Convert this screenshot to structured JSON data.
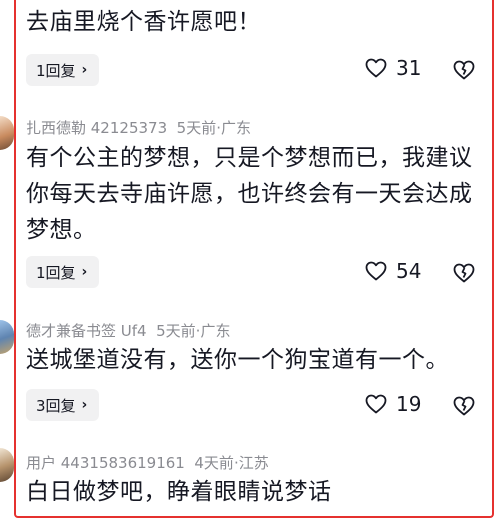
{
  "comments": [
    {
      "text": "去庙里烧个香许愿吧！",
      "reply_label": "1回复",
      "likes": "31",
      "icons": {
        "like": "heart-outline-icon",
        "dislike": "heart-broken-outline-icon",
        "reply_chevron": "chevron-right-icon"
      }
    },
    {
      "username": "扎西德勒 42125373",
      "time": "5天前",
      "location": "广东",
      "separator": "·",
      "text": "有个公主的梦想，只是个梦想而已，我建议\n你每天去寺庙许愿，也许终会有一天会达成\n梦想。",
      "reply_label": "1回复",
      "likes": "54"
    },
    {
      "username": "德才兼备书签 Uf4",
      "time": "5天前",
      "location": "广东",
      "separator": "·",
      "text": "送城堡道没有，送你一个狗宝道有一个。",
      "reply_label": "3回复",
      "likes": "19"
    },
    {
      "username": "用户 4431583619161",
      "time": "4天前",
      "location": "江苏",
      "separator": "·",
      "text": "白日做梦吧，睁着眼睛说梦话"
    }
  ],
  "colors": {
    "frame": "#e5312f",
    "meta": "#8a8b91",
    "text": "#161823",
    "pill": "#f1f1f2"
  }
}
